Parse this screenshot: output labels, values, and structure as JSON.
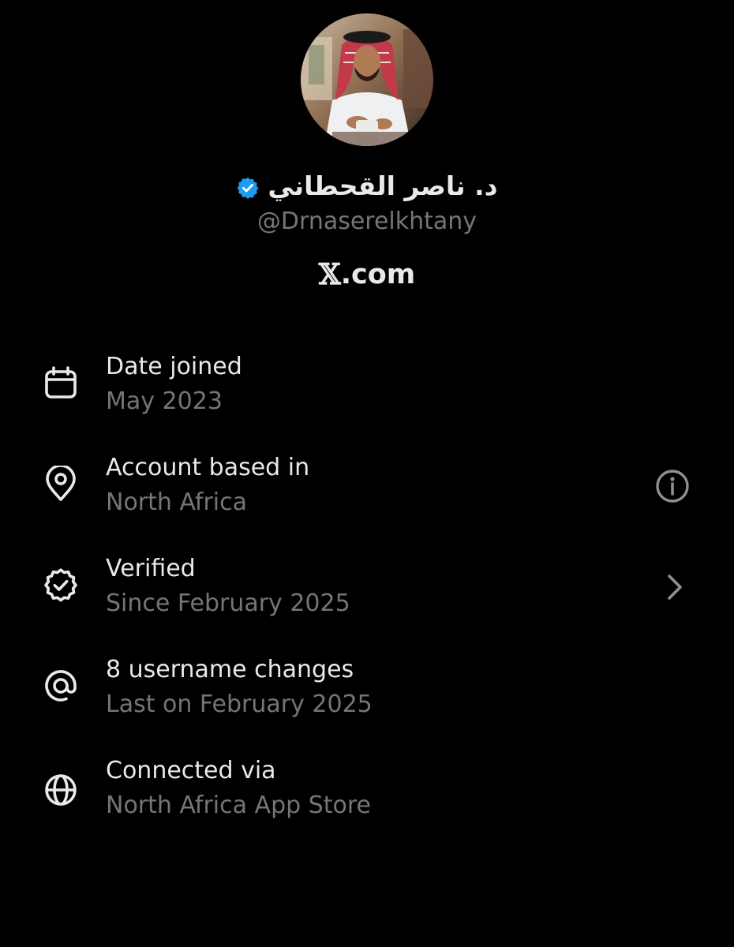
{
  "profile": {
    "display_name": "د. ناصر القحطاني",
    "handle": "@Drnaserelkhtany",
    "site_logo": "𝕏",
    "site_text": ".com"
  },
  "icons": {
    "verified": "verified-badge-icon",
    "calendar": "calendar-icon",
    "location": "location-pin-icon",
    "info": "info-icon",
    "verified_outline": "verified-check-icon",
    "chevron": "chevron-right-icon",
    "at": "at-sign-icon",
    "globe": "globe-icon"
  },
  "about": {
    "rows": [
      {
        "title": "Date joined",
        "subtitle": "May 2023"
      },
      {
        "title": "Account based in",
        "subtitle": "North Africa"
      },
      {
        "title": "Verified",
        "subtitle": "Since February 2025"
      },
      {
        "title": "8 username changes",
        "subtitle": "Last on February 2025"
      },
      {
        "title": "Connected via",
        "subtitle": "North Africa App Store"
      }
    ]
  },
  "colors": {
    "background": "#000000",
    "text_primary": "#e7e9ea",
    "text_secondary": "#71767b",
    "verified_blue": "#1d9bf0"
  }
}
